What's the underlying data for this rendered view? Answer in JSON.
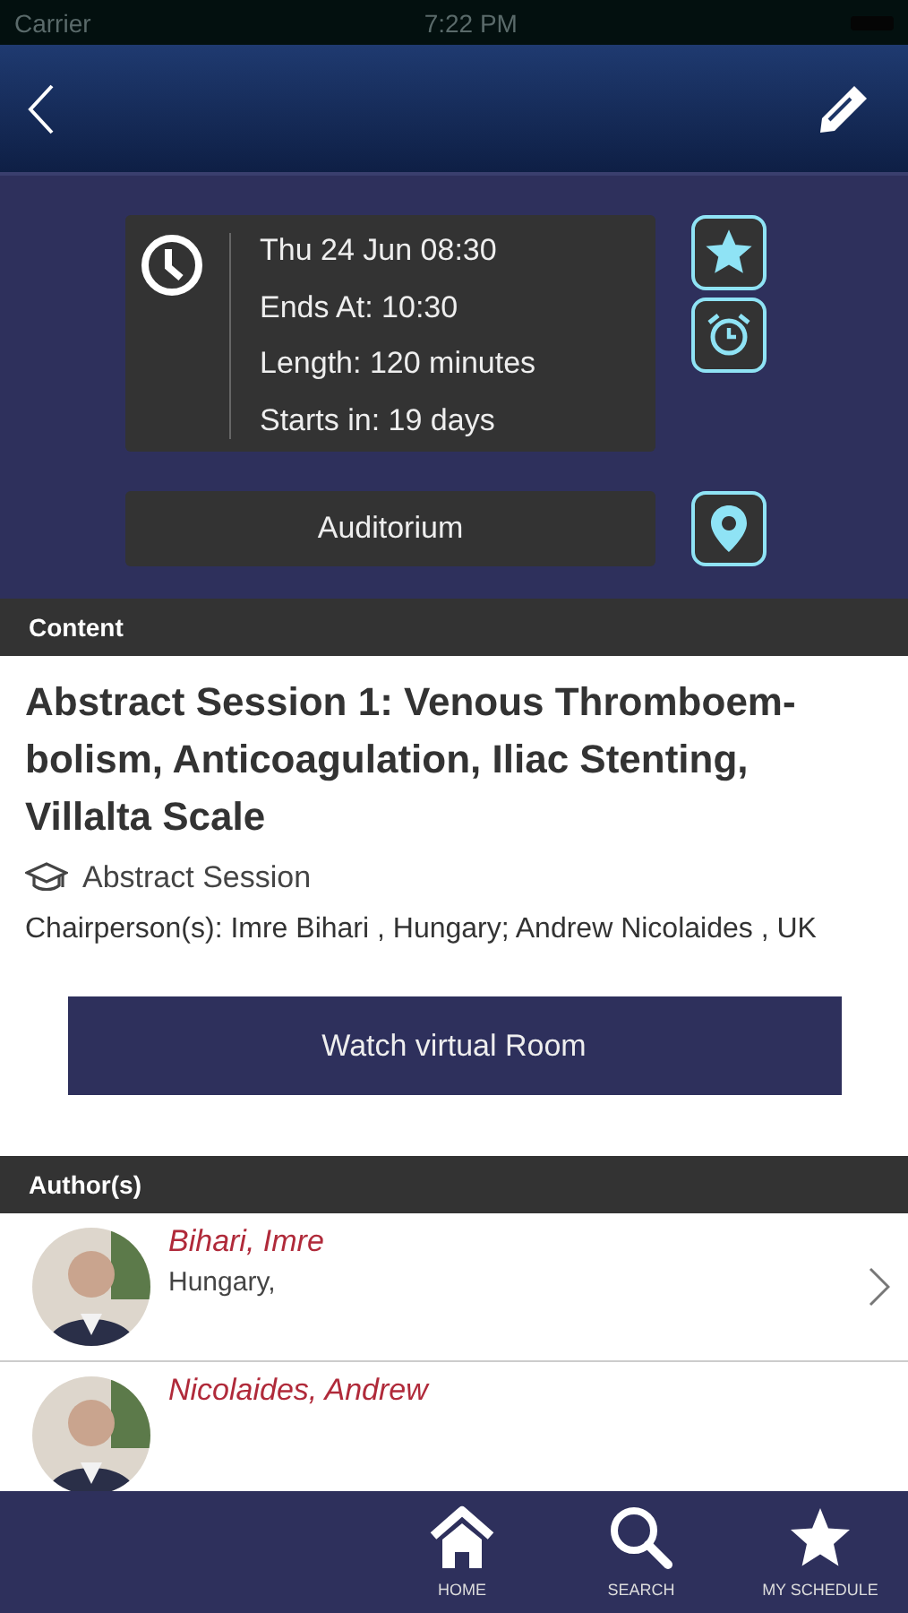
{
  "status_bar": {
    "carrier": "Carrier",
    "time": "7:22 PM"
  },
  "session_info": {
    "date": "Thu 24  Jun  08:30",
    "ends": "Ends At: 10:30",
    "length": "Length: 120 minutes",
    "starts_in": "Starts in: 19 days",
    "favorite": true,
    "location": "Auditorium"
  },
  "content": {
    "header": "Content",
    "title": "Abstract Session 1: Venous Thromboem-bolism, Anticoagulation, Iliac Stenting, Villalta Scale",
    "type": "Abstract Session",
    "chairpersons": "Chairperson(s): Imre Bihari , Hungary; Andrew Nicolaides , UK",
    "button": "Watch virtual Room"
  },
  "authors": {
    "header": "Author(s)",
    "items": [
      {
        "name": "Bihari, Imre",
        "country": "Hungary,"
      },
      {
        "name": "Nicolaides, Andrew"
      }
    ]
  },
  "tab_bar": [
    {
      "label": "HOME",
      "kind": "home"
    },
    {
      "label": "SEARCH",
      "kind": "search"
    },
    {
      "label": "MY SCHEDULE",
      "kind": "star"
    }
  ]
}
